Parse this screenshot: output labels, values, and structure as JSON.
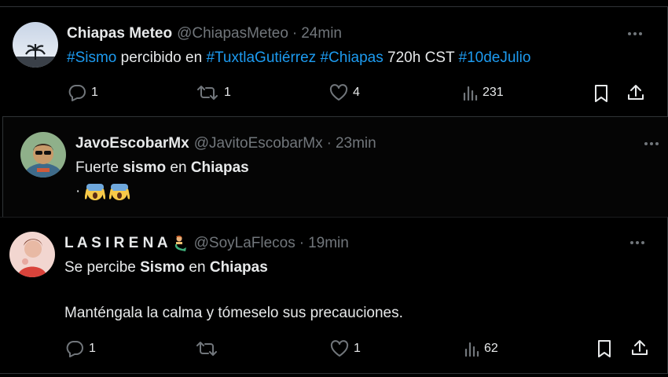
{
  "tweets": [
    {
      "name": "Chiapas Meteo",
      "handle": "@ChiapasMeteo",
      "sep": "·",
      "time": "24min",
      "body": [
        {
          "t": "#Sismo",
          "s": "tag"
        },
        {
          "t": " percibido en ",
          "s": ""
        },
        {
          "t": "#TuxtlaGutiérrez",
          "s": "tag"
        },
        {
          "t": " ",
          "s": ""
        },
        {
          "t": "#Chiapas",
          "s": "tag"
        },
        {
          "t": " 720h CST ",
          "s": ""
        },
        {
          "t": "#10deJulio",
          "s": "tag"
        }
      ],
      "replies": "1",
      "reposts": "1",
      "likes": "4",
      "views": "231"
    },
    {
      "name": "JavoEscobarMx",
      "handle": "@JavitoEscobarMx",
      "sep": "·",
      "time": "23min",
      "line1": [
        {
          "t": "Fuerte ",
          "s": ""
        },
        {
          "t": "sismo",
          "s": "b"
        },
        {
          "t": " en ",
          "s": ""
        },
        {
          "t": "Chiapas",
          "s": "b"
        }
      ],
      "line2_prefix": "·",
      "emojis": [
        "screaming-face-emoji",
        "screaming-face-emoji"
      ]
    },
    {
      "name": "L A S I R E N A",
      "handle": "@SoyLaFlecos",
      "sep": "·",
      "time": "19min",
      "line1": [
        {
          "t": "Se percibe ",
          "s": ""
        },
        {
          "t": "Sismo",
          "s": "b"
        },
        {
          "t": " en ",
          "s": ""
        },
        {
          "t": "Chiapas",
          "s": "b"
        }
      ],
      "line2": "Manténgala la calma y tómeselo sus precauciones.",
      "replies": "1",
      "reposts": "",
      "likes": "1",
      "views": "62"
    }
  ],
  "colors": {
    "accent": "#1d9bf0",
    "muted": "#71767b",
    "text": "#e7e9ea",
    "background": "#000000"
  }
}
